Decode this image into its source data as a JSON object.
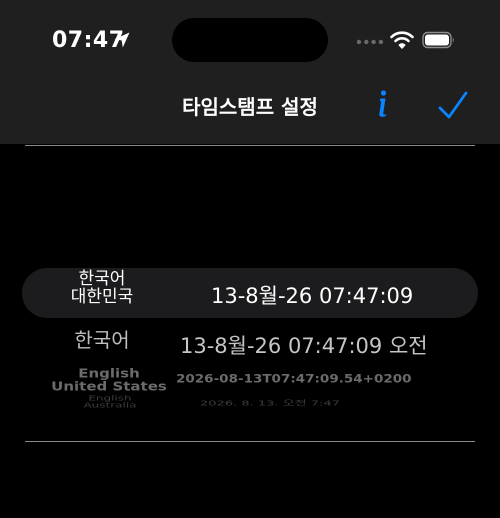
{
  "status_bar": {
    "time": "07:47"
  },
  "nav": {
    "title": "타임스탬프 설정"
  },
  "picker": {
    "rows": [
      {
        "language": "한국어",
        "region": "대한민국",
        "timestamp": "13-8월-26 07:47:09",
        "selected": true
      },
      {
        "language": "한국어",
        "region": "",
        "timestamp": "13-8월-26 07:47:09 오전",
        "selected": false
      },
      {
        "language": "English",
        "region": "United States",
        "timestamp": "2026-08-13T07:47:09.54+0200",
        "selected": false
      },
      {
        "language": "English",
        "region": "Australia",
        "timestamp": "2026. 8. 13. 오전 7:47",
        "selected": false
      }
    ]
  },
  "colors": {
    "accent": "#0a84ff",
    "nav_background": "#1f1f1f",
    "selection_band": "#1c1c1e",
    "divider": "#8a8a8a"
  },
  "icons": {
    "location": "location-arrow-icon",
    "cellular": "cellular-dots-icon",
    "wifi": "wifi-icon",
    "battery": "battery-icon",
    "info": "info-icon",
    "confirm": "checkmark-icon"
  }
}
